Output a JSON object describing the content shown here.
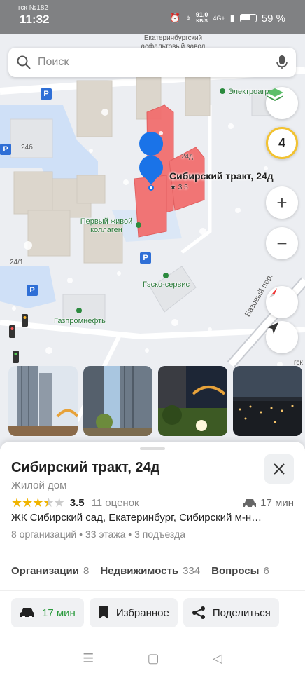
{
  "status_bar": {
    "carrier": "гск №182",
    "time": "11:32",
    "net_speed_value": "91,0",
    "net_speed_unit": "KB/S",
    "signal": "4G+",
    "battery": "59 %"
  },
  "search": {
    "placeholder": "Поиск"
  },
  "map": {
    "labels": {
      "factory": "Екатеринбургский асфальтовый завод",
      "electro": "Электроагре",
      "first_live": "Первый живой коллаген",
      "gas_service": "Гэско-сервис",
      "gazprom": "Газпромнефть",
      "b24b": "24б",
      "b24d": "24д",
      "b24_1": "24/1",
      "street": "Базовый пер.",
      "gsk": "гск"
    },
    "building": {
      "name": "Сибирский тракт, 24д",
      "rating": "★ 3.5"
    },
    "zoom_level": "4",
    "zoom_in": "+",
    "zoom_out": "−"
  },
  "card": {
    "title": "Сибирский тракт, 24д",
    "type": "Жилой дом",
    "rating": "3.5",
    "rating_fraction": 0.7,
    "reviews": "11 оценок",
    "drive_time": "17 мин",
    "address": "ЖК Сибирский сад, Екатеринбург, Сибирский м-н…",
    "meta": "8 организаций • 33 этажа • 3 подъезда",
    "tabs": [
      {
        "name": "Организации",
        "count": "8"
      },
      {
        "name": "Недвижимость",
        "count": "334"
      },
      {
        "name": "Вопросы",
        "count": "6"
      }
    ],
    "actions": {
      "route": "17 мин",
      "favorite": "Избранное",
      "share": "Поделиться"
    }
  },
  "colors": {
    "accent_green": "#2a9a3c",
    "star": "#f0b400",
    "building_highlight": "#f26b6b",
    "pin_blue": "#1a73e8",
    "zoom_ring": "#f2c230"
  }
}
